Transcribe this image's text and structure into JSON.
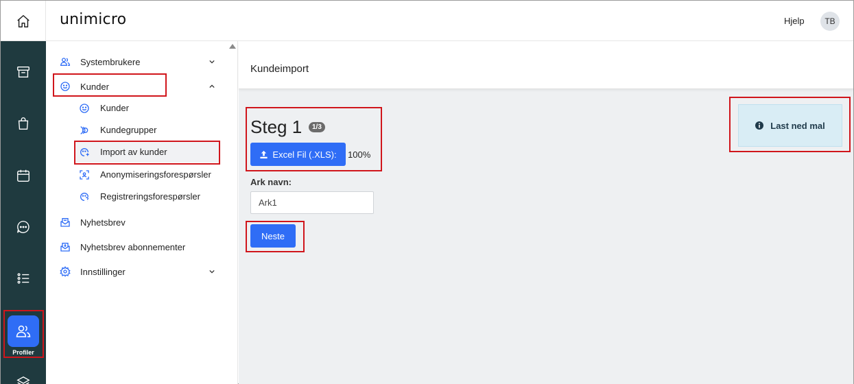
{
  "header": {
    "logo": "unimicro",
    "help_label": "Hjelp",
    "avatar_initials": "TB"
  },
  "rail": {
    "active_label": "Profiler"
  },
  "sidenav": {
    "items": [
      {
        "label": "Systembrukere"
      },
      {
        "label": "Kunder"
      },
      {
        "label": "Nyhetsbrev"
      },
      {
        "label": "Nyhetsbrev abonnementer"
      },
      {
        "label": "Innstillinger"
      }
    ],
    "subitems": [
      {
        "label": "Kunder"
      },
      {
        "label": "Kundegrupper"
      },
      {
        "label": "Import av kunder"
      },
      {
        "label": "Anonymiseringsforespørsler"
      },
      {
        "label": "Registreringsforespørsler"
      }
    ]
  },
  "main": {
    "page_title": "Kundeimport",
    "step_title": "Steg 1",
    "step_badge": "1/3",
    "excel_button": "Excel Fil (.XLS):",
    "upload_progress": "100%",
    "sheet_label": "Ark navn:",
    "sheet_value": "Ark1",
    "next_button": "Neste",
    "download_template": "Last ned mal"
  },
  "colors": {
    "rail_bg": "#1f3a3f",
    "accent": "#2f6df6",
    "highlight": "#d0151b",
    "info_bg": "#d9edf5"
  }
}
